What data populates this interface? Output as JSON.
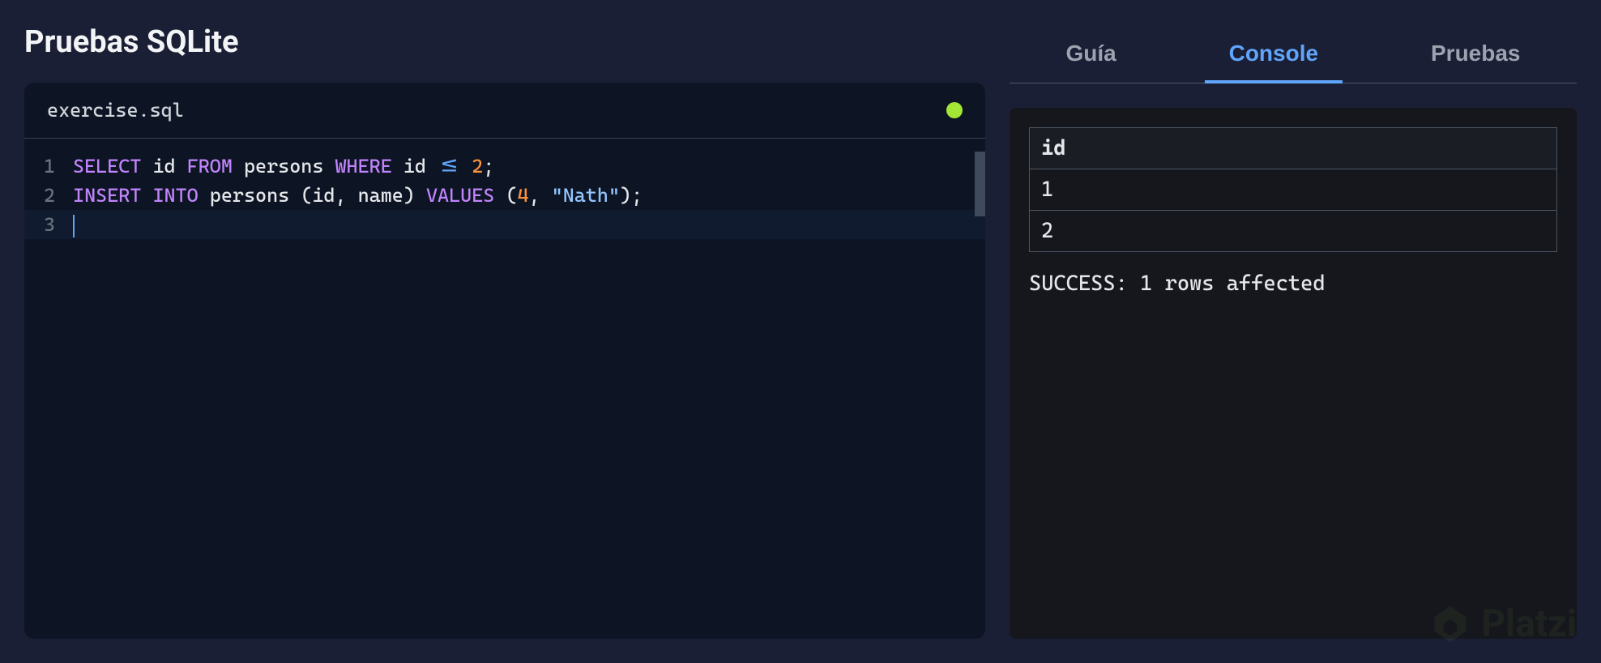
{
  "page": {
    "title": "Pruebas SQLite"
  },
  "editor": {
    "filename": "exercise.sql",
    "lines": [
      {
        "num": "1",
        "tokens": [
          {
            "text": "SELECT",
            "cls": "kw-select"
          },
          {
            "text": " ",
            "cls": ""
          },
          {
            "text": "id",
            "cls": "identifier"
          },
          {
            "text": " ",
            "cls": ""
          },
          {
            "text": "FROM",
            "cls": "kw-from"
          },
          {
            "text": " ",
            "cls": ""
          },
          {
            "text": "persons",
            "cls": "identifier"
          },
          {
            "text": " ",
            "cls": ""
          },
          {
            "text": "WHERE",
            "cls": "kw-where"
          },
          {
            "text": " ",
            "cls": ""
          },
          {
            "text": "id",
            "cls": "identifier"
          },
          {
            "text": " ",
            "cls": ""
          },
          {
            "text": "<=",
            "cls": "operator"
          },
          {
            "text": " ",
            "cls": ""
          },
          {
            "text": "2",
            "cls": "number"
          },
          {
            "text": ";",
            "cls": "punct"
          }
        ]
      },
      {
        "num": "2",
        "tokens": [
          {
            "text": "INSERT",
            "cls": "kw-insert"
          },
          {
            "text": " ",
            "cls": ""
          },
          {
            "text": "INTO",
            "cls": "kw-into"
          },
          {
            "text": " ",
            "cls": ""
          },
          {
            "text": "persons",
            "cls": "identifier"
          },
          {
            "text": " ",
            "cls": ""
          },
          {
            "text": "(",
            "cls": "punct"
          },
          {
            "text": "id",
            "cls": "identifier"
          },
          {
            "text": ",",
            "cls": "punct"
          },
          {
            "text": " ",
            "cls": ""
          },
          {
            "text": "name",
            "cls": "identifier"
          },
          {
            "text": ")",
            "cls": "punct"
          },
          {
            "text": " ",
            "cls": ""
          },
          {
            "text": "VALUES",
            "cls": "kw-values"
          },
          {
            "text": " ",
            "cls": ""
          },
          {
            "text": "(",
            "cls": "punct"
          },
          {
            "text": "4",
            "cls": "number"
          },
          {
            "text": ",",
            "cls": "punct"
          },
          {
            "text": " ",
            "cls": ""
          },
          {
            "text": "\"Nath\"",
            "cls": "string"
          },
          {
            "text": ")",
            "cls": "punct"
          },
          {
            "text": ";",
            "cls": "punct"
          }
        ]
      },
      {
        "num": "3",
        "active": true,
        "tokens": []
      }
    ]
  },
  "tabs": {
    "items": [
      {
        "label": "Guía",
        "active": false
      },
      {
        "label": "Console",
        "active": true
      },
      {
        "label": "Pruebas",
        "active": false
      }
    ]
  },
  "console": {
    "table": {
      "header": "id",
      "rows": [
        "1",
        "2"
      ]
    },
    "status": "SUCCESS: 1 rows affected"
  },
  "watermark": {
    "text": "Platzi"
  }
}
